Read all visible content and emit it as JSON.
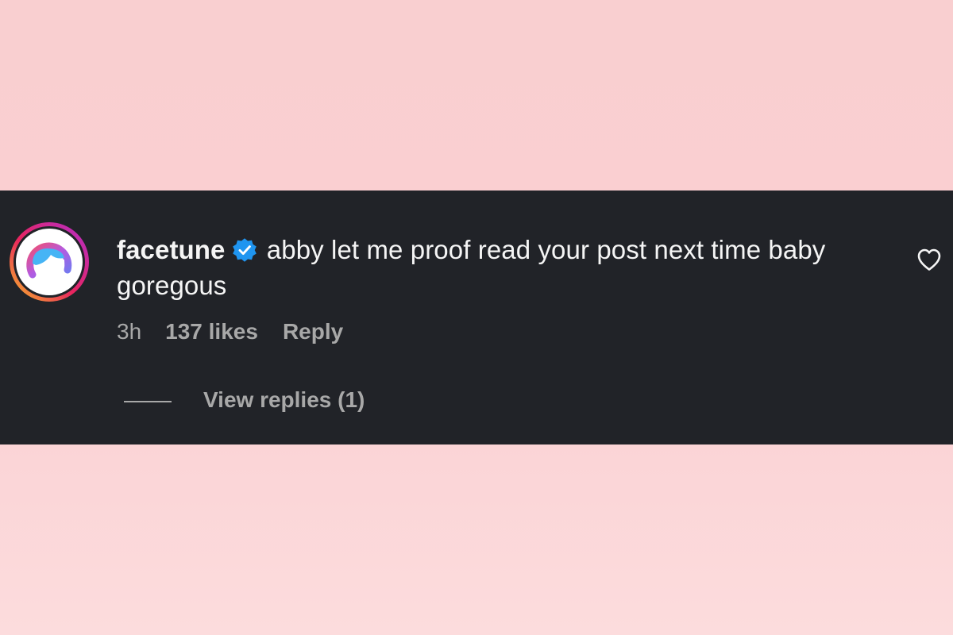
{
  "comment": {
    "username": "facetune",
    "verified_icon": "verified-badge-icon",
    "text": "abby let me proof read your post next time baby goregous",
    "time": "3h",
    "likes": "137 likes",
    "reply_label": "Reply",
    "view_replies": "View replies (1)",
    "like_icon": "heart-outline-icon"
  },
  "colors": {
    "page_background": "#f9cfd0",
    "panel_background": "#212328",
    "primary_text": "#f5f5f5",
    "secondary_text": "#a8a8a8",
    "verified_blue": "#1f95f0"
  }
}
